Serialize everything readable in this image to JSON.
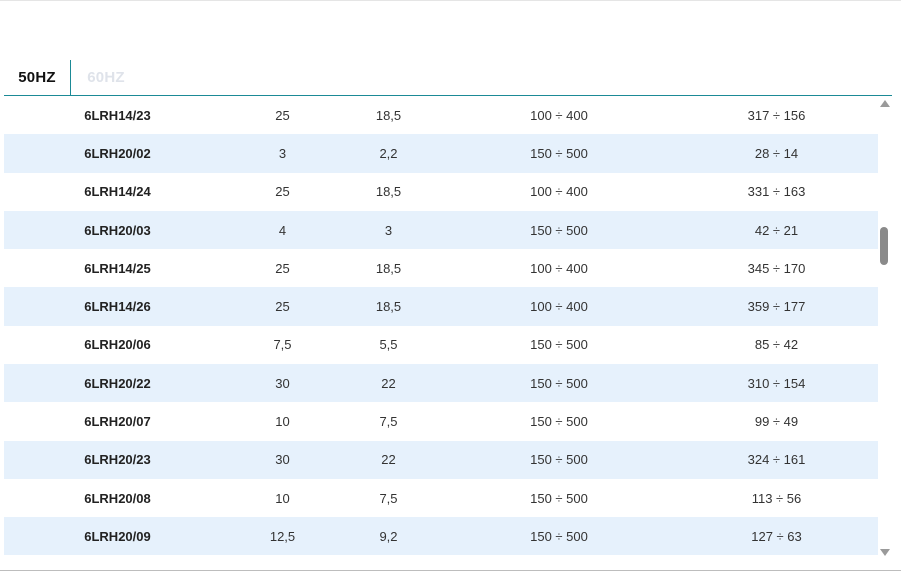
{
  "tabs": [
    {
      "label": "50HZ",
      "active": true
    },
    {
      "label": "60HZ",
      "active": false
    }
  ],
  "table": {
    "rows": [
      [
        "6LRH14/23",
        "25",
        "18,5",
        "100 ÷ 400",
        "317 ÷ 156"
      ],
      [
        "6LRH20/02",
        "3",
        "2,2",
        "150 ÷ 500",
        "28 ÷ 14"
      ],
      [
        "6LRH14/24",
        "25",
        "18,5",
        "100 ÷ 400",
        "331 ÷ 163"
      ],
      [
        "6LRH20/03",
        "4",
        "3",
        "150 ÷ 500",
        "42 ÷ 21"
      ],
      [
        "6LRH14/25",
        "25",
        "18,5",
        "100 ÷ 400",
        "345 ÷ 170"
      ],
      [
        "6LRH14/26",
        "25",
        "18,5",
        "100 ÷ 400",
        "359 ÷ 177"
      ],
      [
        "6LRH20/06",
        "7,5",
        "5,5",
        "150 ÷ 500",
        "85 ÷ 42"
      ],
      [
        "6LRH20/22",
        "30",
        "22",
        "150 ÷ 500",
        "310 ÷ 154"
      ],
      [
        "6LRH20/07",
        "10",
        "7,5",
        "150 ÷ 500",
        "99 ÷ 49"
      ],
      [
        "6LRH20/23",
        "30",
        "22",
        "150 ÷ 500",
        "324 ÷ 161"
      ],
      [
        "6LRH20/08",
        "10",
        "7,5",
        "150 ÷ 500",
        "113 ÷ 56"
      ],
      [
        "6LRH20/09",
        "12,5",
        "9,2",
        "150 ÷ 500",
        "127 ÷ 63"
      ]
    ]
  },
  "colors": {
    "accent": "#1b8a96",
    "row_alt": "#e6f1fc",
    "inactive_tab": "#dfe3ea"
  }
}
